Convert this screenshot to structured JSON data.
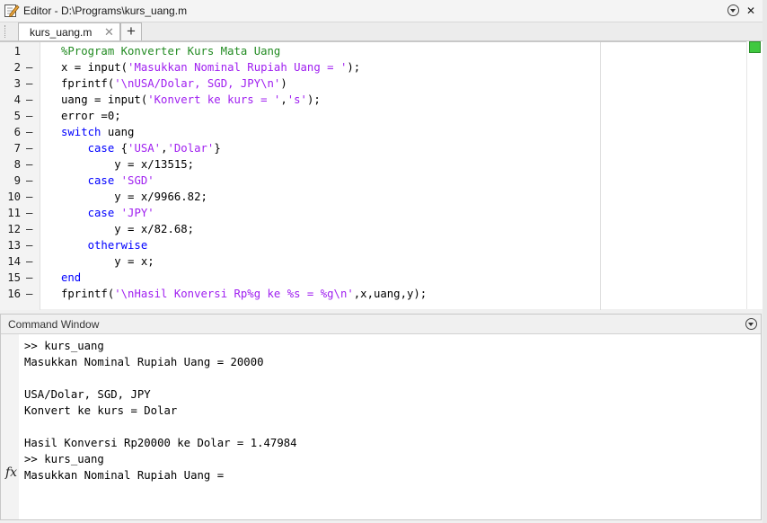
{
  "editor": {
    "title": "Editor - D:\\Programs\\kurs_uang.m",
    "tab_label": "kurs_uang.m",
    "tab_close": "✕",
    "tab_add": "+",
    "close_glyph": "✕"
  },
  "code_lines": [
    {
      "n": "1",
      "dash": "",
      "segments": [
        {
          "t": "%Program Konverter Kurs Mata Uang",
          "c": "cmt"
        }
      ]
    },
    {
      "n": "2",
      "dash": "–",
      "segments": [
        {
          "t": "x = input(",
          "c": "txt"
        },
        {
          "t": "'Masukkan Nominal Rupiah Uang = '",
          "c": "str"
        },
        {
          "t": ");",
          "c": "txt"
        }
      ]
    },
    {
      "n": "3",
      "dash": "–",
      "segments": [
        {
          "t": "fprintf(",
          "c": "txt"
        },
        {
          "t": "'\\nUSA/Dolar, SGD, JPY\\n'",
          "c": "str"
        },
        {
          "t": ")",
          "c": "txt"
        }
      ]
    },
    {
      "n": "4",
      "dash": "–",
      "segments": [
        {
          "t": "uang = input(",
          "c": "txt"
        },
        {
          "t": "'Konvert ke kurs = '",
          "c": "str"
        },
        {
          "t": ",",
          "c": "txt"
        },
        {
          "t": "'s'",
          "c": "str"
        },
        {
          "t": ");",
          "c": "txt"
        }
      ]
    },
    {
      "n": "5",
      "dash": "–",
      "segments": [
        {
          "t": "error =0;",
          "c": "txt"
        }
      ]
    },
    {
      "n": "6",
      "dash": "–",
      "segments": [
        {
          "t": "switch",
          "c": "kw"
        },
        {
          "t": " uang",
          "c": "txt"
        }
      ]
    },
    {
      "n": "7",
      "dash": "–",
      "segments": [
        {
          "t": "    case",
          "c": "kw"
        },
        {
          "t": " {",
          "c": "txt"
        },
        {
          "t": "'USA'",
          "c": "str"
        },
        {
          "t": ",",
          "c": "txt"
        },
        {
          "t": "'Dolar'",
          "c": "str"
        },
        {
          "t": "}",
          "c": "txt"
        }
      ]
    },
    {
      "n": "8",
      "dash": "–",
      "segments": [
        {
          "t": "        y = x/13515;",
          "c": "txt"
        }
      ]
    },
    {
      "n": "9",
      "dash": "–",
      "segments": [
        {
          "t": "    case",
          "c": "kw"
        },
        {
          "t": " ",
          "c": "txt"
        },
        {
          "t": "'SGD'",
          "c": "str"
        }
      ]
    },
    {
      "n": "10",
      "dash": "–",
      "segments": [
        {
          "t": "        y = x/9966.82;",
          "c": "txt"
        }
      ]
    },
    {
      "n": "11",
      "dash": "–",
      "segments": [
        {
          "t": "    case",
          "c": "kw"
        },
        {
          "t": " ",
          "c": "txt"
        },
        {
          "t": "'JPY'",
          "c": "str"
        }
      ]
    },
    {
      "n": "12",
      "dash": "–",
      "segments": [
        {
          "t": "        y = x/82.68;",
          "c": "txt"
        }
      ]
    },
    {
      "n": "13",
      "dash": "–",
      "segments": [
        {
          "t": "    otherwise",
          "c": "kw"
        }
      ]
    },
    {
      "n": "14",
      "dash": "–",
      "segments": [
        {
          "t": "        y = x;",
          "c": "txt"
        }
      ]
    },
    {
      "n": "15",
      "dash": "–",
      "segments": [
        {
          "t": "end",
          "c": "kw"
        }
      ]
    },
    {
      "n": "16",
      "dash": "–",
      "segments": [
        {
          "t": "fprintf(",
          "c": "txt"
        },
        {
          "t": "'\\nHasil Konversi Rp%g ke %s = %g\\n'",
          "c": "str"
        },
        {
          "t": ",x,uang,y);",
          "c": "txt"
        }
      ]
    }
  ],
  "command_window": {
    "title": "Command Window",
    "lines": [
      ">> kurs_uang",
      "Masukkan Nominal Rupiah Uang = 20000",
      "",
      "USA/Dolar, SGD, JPY",
      "Konvert ke kurs = Dolar",
      "",
      "Hasil Konversi Rp20000 ke Dolar = 1.47984",
      ">> kurs_uang",
      "Masukkan Nominal Rupiah Uang ="
    ],
    "fx_label": "fx"
  },
  "colors": {
    "comment": "#228b22",
    "string": "#a020f0",
    "keyword": "#0000ff",
    "status_ok": "#3fc83f"
  }
}
